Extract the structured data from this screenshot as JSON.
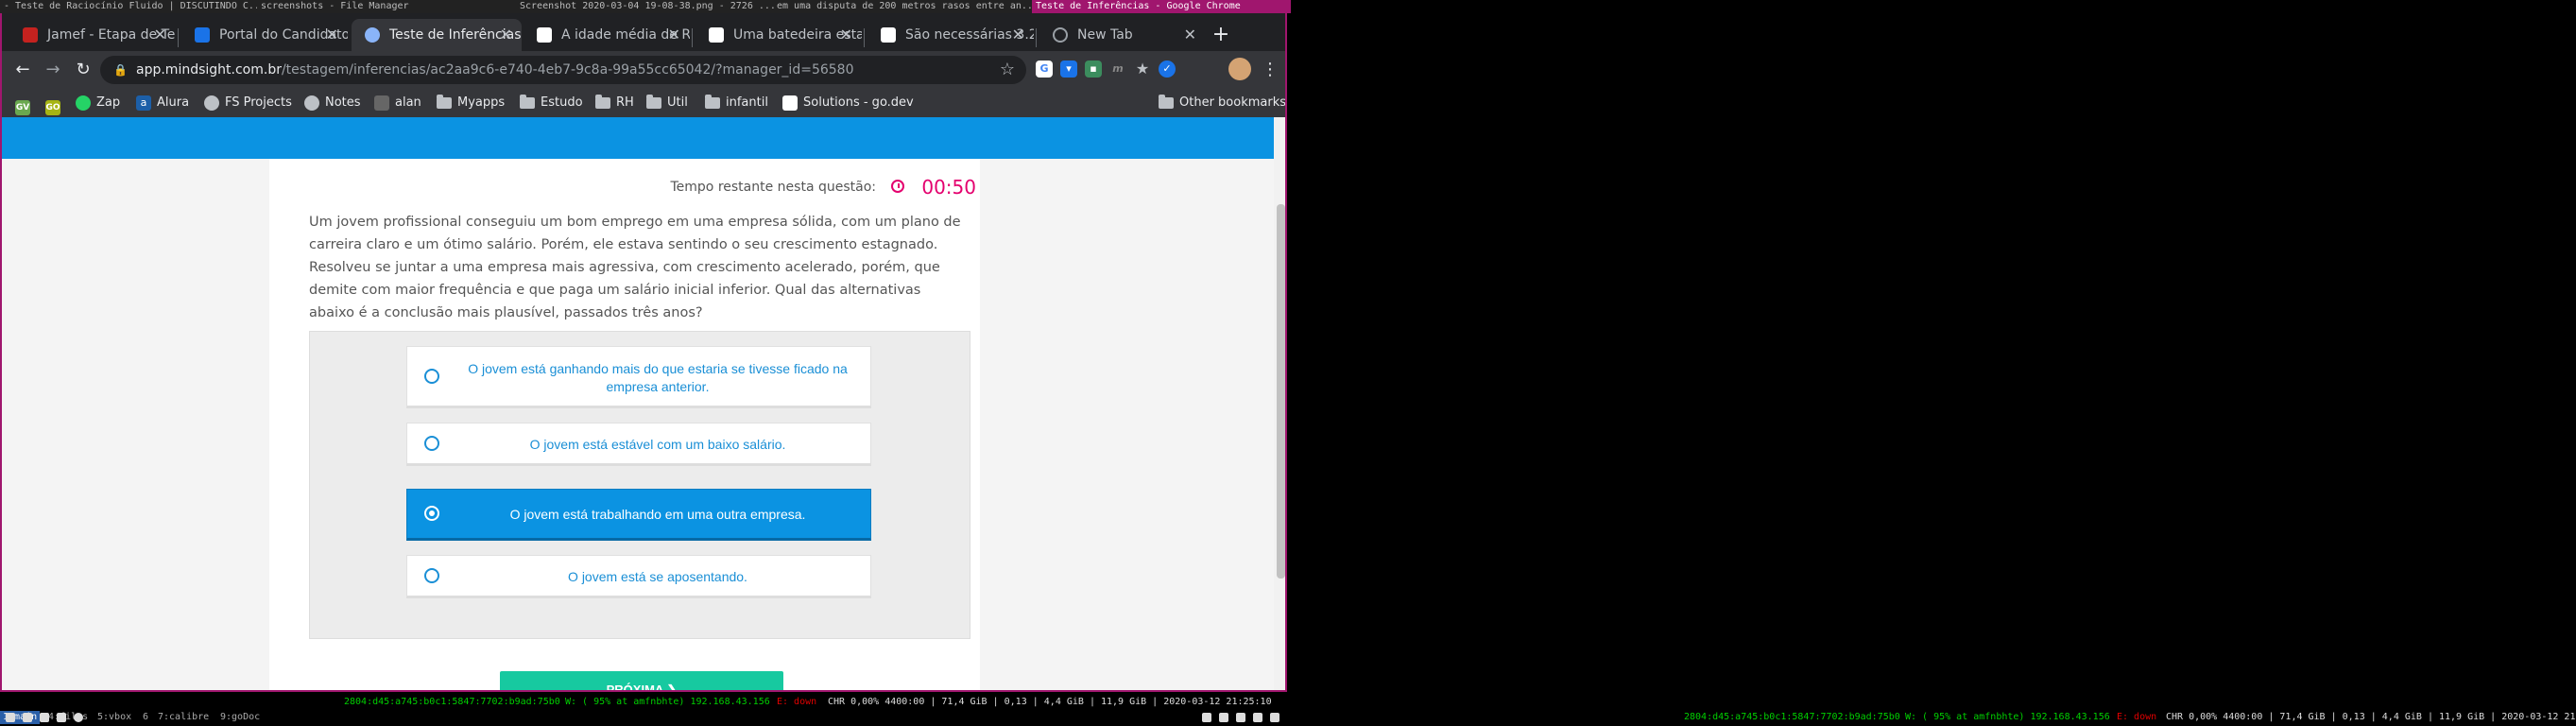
{
  "wm": {
    "segments": [
      "- Teste de Raciocínio Fluido | DISCUTINDO C...",
      "screenshots - File Manager",
      "Screenshot 2020-03-04 19-08-38.png - 2726 ...",
      "em uma disputa de 200 metros rasos entre an...",
      "Teste de Inferências - Google Chrome"
    ]
  },
  "tabs": [
    {
      "label": "Jamef - Etapa de Te",
      "color": "#c5221f"
    },
    {
      "label": "Portal do Candidato",
      "color": "#1a73e8"
    },
    {
      "label": "Teste de Inferências",
      "color": "#8ab4f8"
    },
    {
      "label": "A idade média de R",
      "color": "#ffffff"
    },
    {
      "label": "Uma batedeira esta",
      "color": "#ffffff"
    },
    {
      "label": "São necessárias 3.2",
      "color": "#ffffff"
    },
    {
      "label": "New Tab",
      "color": "#9aa0a6"
    }
  ],
  "omnibox": {
    "domain": "app.mindsight.com.br",
    "path": "/testagem/inferencias/ac2aa9c6-e740-4eb7-9c8a-99a55cc65042/?manager_id=56580"
  },
  "bookmarks": [
    {
      "label": "",
      "type": "ic",
      "color": "#6aa84f",
      "text": "GV"
    },
    {
      "label": "",
      "type": "ic",
      "color": "#a6b414",
      "text": "GO"
    },
    {
      "label": "Zap",
      "type": "ic",
      "color": "#25d366",
      "text": ""
    },
    {
      "label": "Alura",
      "type": "ic",
      "color": "#1c5fa8",
      "text": "a"
    },
    {
      "label": "FS Projects",
      "type": "globe"
    },
    {
      "label": "Notes",
      "type": "globe"
    },
    {
      "label": "alan",
      "type": "ic",
      "color": "#666",
      "text": ""
    },
    {
      "label": "Myapps",
      "type": "folder"
    },
    {
      "label": "Estudo",
      "type": "folder"
    },
    {
      "label": "RH",
      "type": "folder"
    },
    {
      "label": "Util",
      "type": "folder"
    },
    {
      "label": "infantil",
      "type": "folder"
    },
    {
      "label": "Solutions - go.dev",
      "type": "ic",
      "color": "#ffffff",
      "text": ""
    }
  ],
  "other_bookmarks": "Other bookmarks",
  "page": {
    "timer_label": "Tempo restante nesta questão:",
    "timer_value": "00:50",
    "question": "Um jovem profissional conseguiu um bom emprego em uma empresa sólida, com um plano de carreira claro e um ótimo salário. Porém, ele estava sentindo o seu crescimento estagnado. Resolveu se juntar a uma empresa mais agressiva, com crescimento acelerado, porém, que demite com maior frequência e que paga um salário inicial inferior. Qual das alternativas abaixo é a conclusão mais plausível, passados três anos?",
    "options": [
      "O jovem está ganhando mais do que estaria se tivesse ficado na empresa anterior.",
      "O jovem está estável com um baixo salário.",
      "O jovem está trabalhando em uma outra empresa.",
      "O jovem está se aposentando."
    ],
    "selected_option": 2,
    "next_label": "PRÓXIMA"
  },
  "status": {
    "workspaces": [
      "1:main",
      "4:files",
      "5:vbox",
      "6",
      "7:calibre",
      "9:goDoc"
    ],
    "left_ipv6": "2804:d45:a745:b0c1:5847:7702:b9ad:75b0",
    "left_wifi": "W: ( 95% at amfnbhte) 192.168.43.156",
    "left_eth": "E: down",
    "left_rest": "CHR 0,00% 4400:00 | 71,4 GiB | 0,13 | 4,4 GiB | 11,9 GiB | 2020-03-12 21:25:10",
    "right_ipv6": "2804:d45:a745:b0c1:5847:7702:b9ad:75b0",
    "right_wifi": "W: ( 95% at amfnbhte) 192.168.43.156",
    "right_eth": "E: down",
    "right_rest": "CHR 0,00% 4400:00 | 71,4 GiB | 0,13 | 4,4 GiB | 11,9 GiB | 2020-03-12 21:25:10",
    "tray_num": "2"
  }
}
